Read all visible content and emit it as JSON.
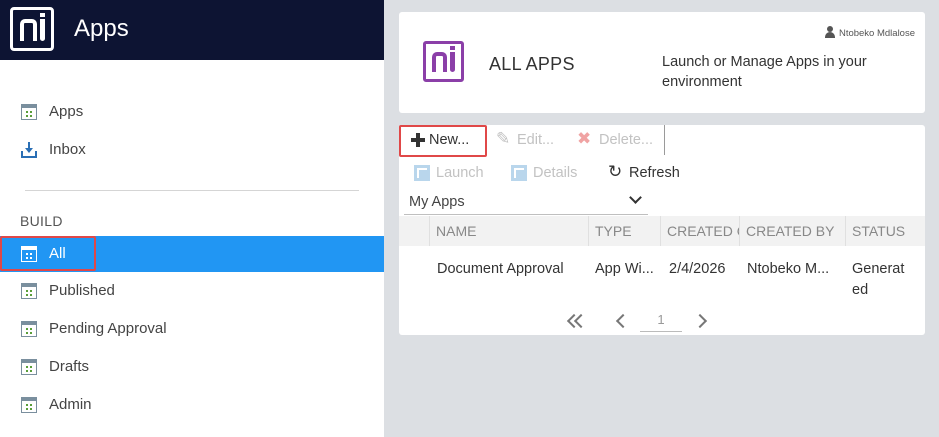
{
  "header": {
    "title": "Apps",
    "logo_icon": "nintex-logo-icon"
  },
  "sidebar": {
    "top_items": [
      {
        "label": "Apps",
        "icon": "window-icon"
      },
      {
        "label": "Inbox",
        "icon": "inbox-icon"
      }
    ],
    "section_title": "BUILD",
    "build_items": [
      {
        "label": "All",
        "icon": "window-icon",
        "active": true
      },
      {
        "label": "Published",
        "icon": "window-icon"
      },
      {
        "label": "Pending Approval",
        "icon": "window-icon"
      },
      {
        "label": "Drafts",
        "icon": "window-icon"
      },
      {
        "label": "Admin",
        "icon": "window-icon"
      }
    ]
  },
  "banner": {
    "title": "ALL APPS",
    "description": "Launch or Manage Apps in your environment",
    "user": "Ntobeko Mdlalose"
  },
  "toolbar": {
    "new": "New...",
    "edit": "Edit...",
    "delete": "Delete...",
    "launch": "Launch",
    "details": "Details",
    "refresh": "Refresh"
  },
  "view_select": {
    "value": "My Apps"
  },
  "table": {
    "columns": [
      "NAME",
      "TYPE",
      "CREATED O",
      "CREATED BY",
      "STATUS"
    ],
    "rows": [
      {
        "name": "Document Approval",
        "type": "App Wi...",
        "created_on": "2/4/2026",
        "created_by": "Ntobeko M...",
        "status_line1": "Generat",
        "status_line2": "ed"
      }
    ]
  },
  "pager": {
    "page": "1"
  },
  "colors": {
    "sidebar_header": "#0d1433",
    "active_item": "#2196f3",
    "highlight": "#e04848",
    "brand_purple": "#8b3fa8"
  }
}
